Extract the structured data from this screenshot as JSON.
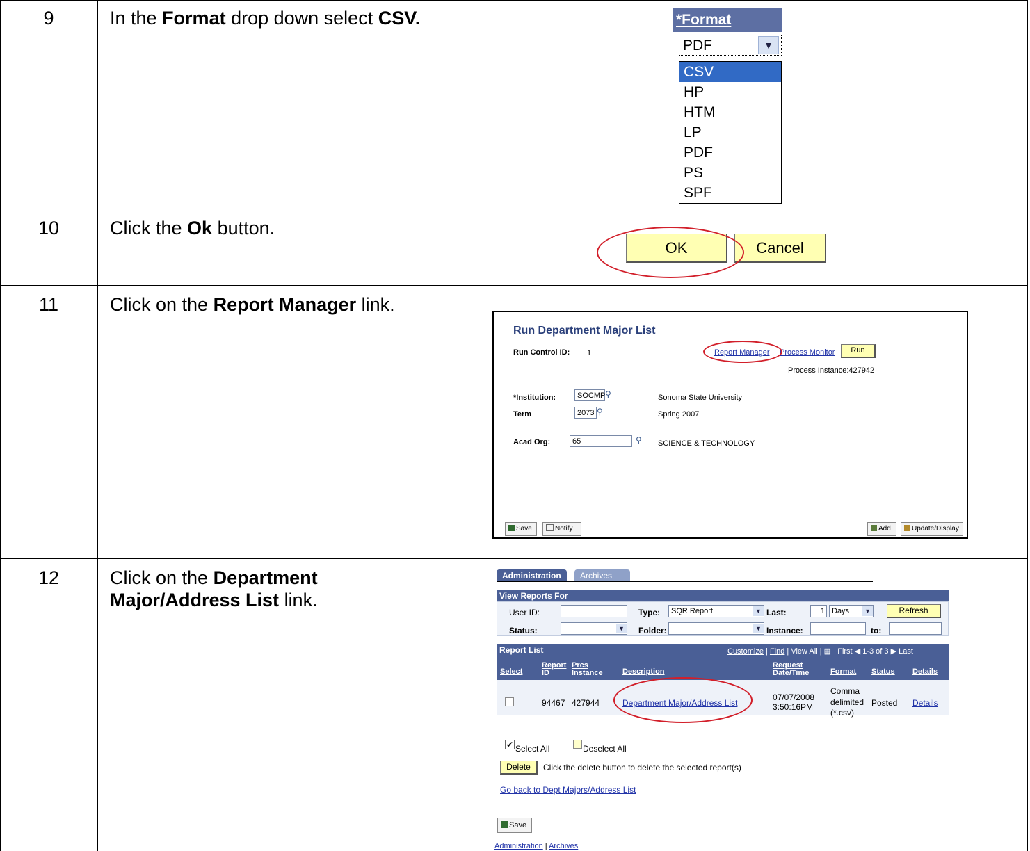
{
  "steps": [
    {
      "number": "9",
      "text_before": "In the ",
      "bold": "Format",
      "text_after": " drop down select ",
      "bold2": "CSV."
    },
    {
      "number": "10",
      "text_before": "Click the ",
      "bold": "Ok",
      "text_after": " button."
    },
    {
      "number": "11",
      "text_before": "Click on the ",
      "bold": "Report Manager",
      "text_after": " link."
    },
    {
      "number": "12",
      "text_before": "Click on the ",
      "bold": "Department Major/Address List",
      "text_after": " link."
    }
  ],
  "format_dropdown": {
    "label": "*Format",
    "selected": "PDF",
    "options": [
      "CSV",
      "HP",
      "HTM",
      "LP",
      "PDF",
      "PS",
      "SPF"
    ],
    "highlighted": "CSV"
  },
  "ok_cancel": {
    "ok": "OK",
    "cancel": "Cancel"
  },
  "run_page": {
    "title": "Run Department Major List",
    "run_control_label": "Run Control ID:",
    "run_control_value": "1",
    "report_manager": "Report Manager",
    "process_monitor": "Process Monitor",
    "run": "Run",
    "process_instance": "Process Instance:427942",
    "institution_label": "*Institution:",
    "institution_value": "SOCMP",
    "institution_desc": "Sonoma State University",
    "term_label": "Term",
    "term_value": "2073",
    "term_desc": "Spring 2007",
    "acad_org_label": "Acad Org:",
    "acad_org_value": "65",
    "acad_org_desc": "SCIENCE & TECHNOLOGY",
    "save": "Save",
    "notify": "Notify",
    "add": "Add",
    "update_display": "Update/Display"
  },
  "report_manager": {
    "tabs": [
      "Administration",
      "Archives"
    ],
    "view_reports_for": "View Reports For",
    "user_id_label": "User ID:",
    "user_id_value": "",
    "type_label": "Type:",
    "type_value": "SQR Report",
    "last_label": "Last:",
    "last_num": "1",
    "last_unit": "Days",
    "refresh": "Refresh",
    "status_label": "Status:",
    "folder_label": "Folder:",
    "instance_label": "Instance:",
    "to_label": "to:",
    "report_list": "Report List",
    "customize": "Customize",
    "find": "Find",
    "view_all": "View All",
    "first": "First",
    "range": "1-3 of 3",
    "last_nav": "Last",
    "columns": [
      "Select",
      "Report ID",
      "Prcs Instance",
      "Description",
      "Request Date/Time",
      "Format",
      "Status",
      "Details"
    ],
    "row": {
      "report_id": "94467",
      "prcs_instance": "427944",
      "description": "Department Major/Address List",
      "date": "07/07/2008",
      "time": "3:50:16PM",
      "format_1": "Comma",
      "format_2": "delimited",
      "format_3": "(*.csv)",
      "status": "Posted",
      "details": "Details"
    },
    "select_all": "Select All",
    "deselect_all": "Deselect All",
    "delete": "Delete",
    "delete_hint": "Click the delete button to delete the selected report(s)",
    "go_back": "Go back to Dept Majors/Address List",
    "save": "Save",
    "footer_admin": "Administration",
    "footer_archives": "Archives"
  },
  "colors": {
    "accent_blue": "#4a5f96",
    "highlight_red": "#d21f2a",
    "button_yellow": "#ffffb3"
  }
}
